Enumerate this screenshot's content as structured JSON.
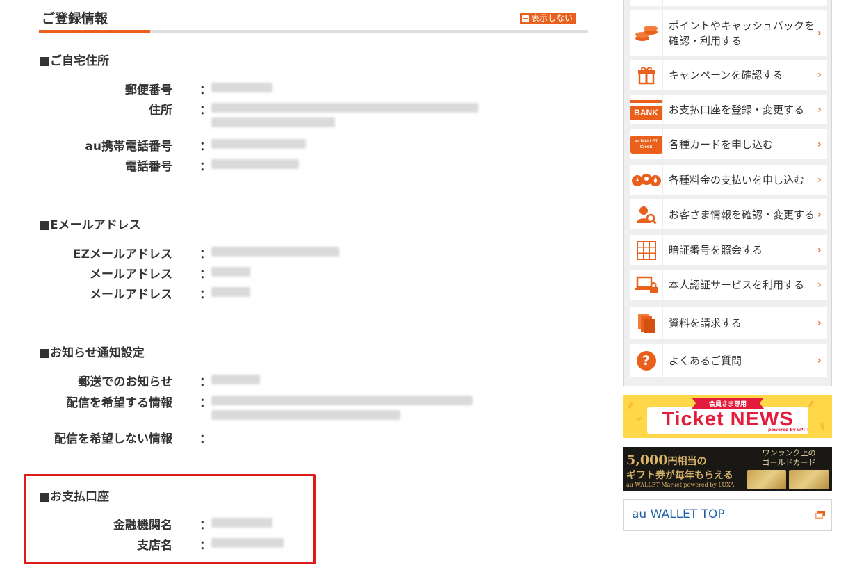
{
  "header": {
    "title": "ご登録情報",
    "toggle_label": "表示しない"
  },
  "sections": {
    "home_address": {
      "title": "■ご自宅住所",
      "rows": [
        {
          "label": "郵便番号"
        },
        {
          "label": "住所"
        },
        {
          "label": "au携帯電話番号"
        },
        {
          "label": "電話番号"
        }
      ]
    },
    "email": {
      "title": "■Eメールアドレス",
      "rows": [
        {
          "label": "EZメールアドレス"
        },
        {
          "label": "メールアドレス"
        },
        {
          "label": "メールアドレス"
        }
      ]
    },
    "notification": {
      "title": "■お知らせ通知設定",
      "rows": [
        {
          "label": "郵送でのお知らせ"
        },
        {
          "label": "配信を希望する情報"
        },
        {
          "label": "配信を希望しない情報"
        }
      ]
    },
    "payment_account": {
      "title": "■お支払口座",
      "rows": [
        {
          "label": "金融機関名"
        },
        {
          "label": "支店名"
        }
      ]
    }
  },
  "colon": "：",
  "sidebar": {
    "items": [
      {
        "label": "ポイントやキャッシュバックを確認・利用する",
        "icon": "coins-icon"
      },
      {
        "label": "キャンペーンを確認する",
        "icon": "gift-icon"
      },
      {
        "label": "お支払口座を登録・変更する",
        "icon": "bank-icon",
        "icon_text": "BANK"
      },
      {
        "label": "各種カードを申し込む",
        "icon": "credit-card-icon",
        "icon_text": "au WALLET Credit"
      },
      {
        "label": "各種料金の支払いを申し込む",
        "icon": "utilities-icon"
      },
      {
        "label": "お客さま情報を確認・変更する",
        "icon": "user-search-icon"
      },
      {
        "label": "暗証番号を照会する",
        "icon": "keypad-icon"
      },
      {
        "label": "本人認証サービスを利用する",
        "icon": "laptop-lock-icon"
      },
      {
        "label": "資料を請求する",
        "icon": "documents-icon"
      },
      {
        "label": "よくあるご質問",
        "icon": "question-icon",
        "icon_text": "?"
      }
    ],
    "chevron": "›"
  },
  "banners": {
    "ticket": {
      "badge": "会員さま専用",
      "title": "Ticket NEWS",
      "sub": "powered by uP!!!"
    },
    "gold": {
      "headline": "5,000",
      "unit": "円相当の",
      "line2": "ギフト券が毎年もらえる",
      "right1": "ワンランク上の",
      "right2": "ゴールドカード",
      "footer": "au WALLET Market powered by LUXA"
    }
  },
  "wallet_top": {
    "label": "au WALLET TOP"
  },
  "colors": {
    "accent": "#e8601b",
    "highlight": "#dd1b1b",
    "link": "#1f5fa8"
  }
}
